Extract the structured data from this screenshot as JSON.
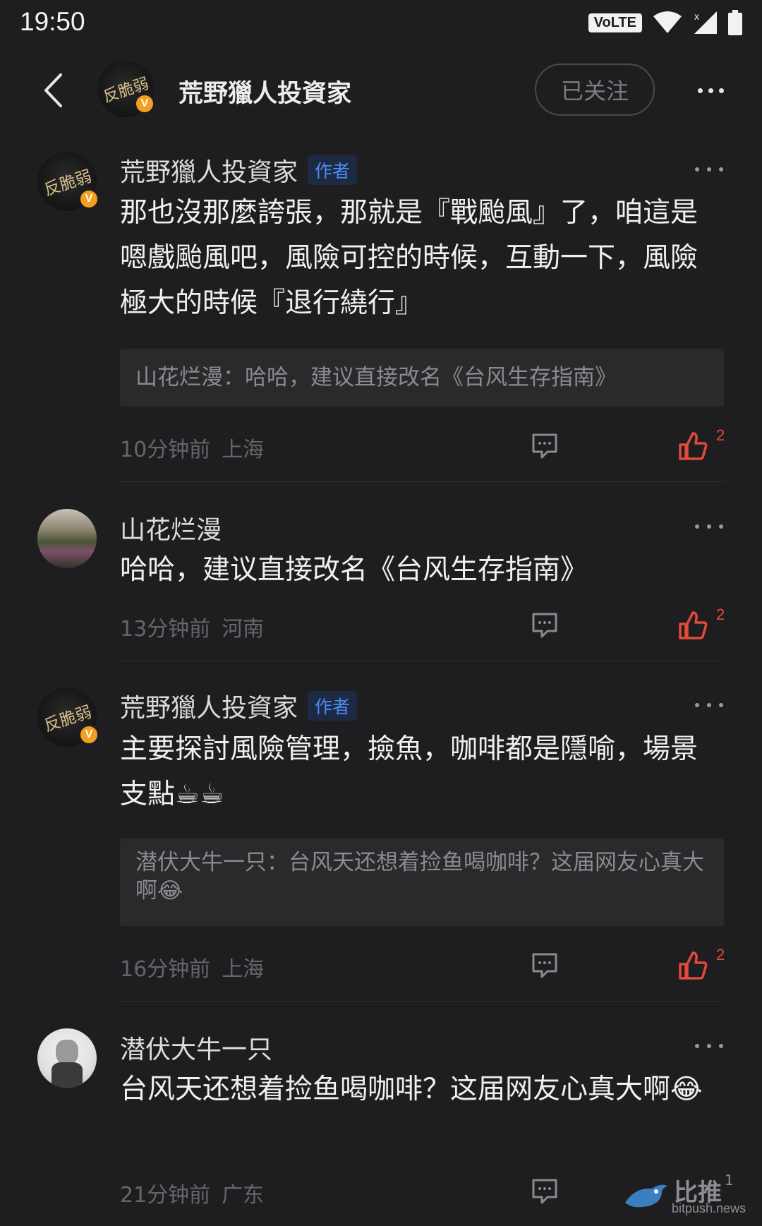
{
  "status_bar": {
    "time": "19:50",
    "network": "VoLTE"
  },
  "header": {
    "title": "荒野獵人投資家",
    "avatar_text": "反脆弱",
    "verified_mark": "V",
    "follow_label": "已关注"
  },
  "comments": [
    {
      "name": "荒野獵人投資家",
      "tag": "作者",
      "avatar_text": "反脆弱",
      "text": "那也沒那麼誇張，那就是『戰颱風』了，咱這是嗯戲颱風吧，風險可控的時候，互動一下，風險極大的時候『退行繞行』",
      "quote": "山花烂漫：哈哈，建议直接改名《台风生存指南》",
      "time": "10分钟前",
      "location": "上海",
      "likes": "2"
    },
    {
      "name": "山花烂漫",
      "text": "哈哈，建议直接改名《台风生存指南》",
      "time": "13分钟前",
      "location": "河南",
      "likes": "2"
    },
    {
      "name": "荒野獵人投資家",
      "tag": "作者",
      "avatar_text": "反脆弱",
      "text": "主要探討風險管理，撿魚，咖啡都是隱喻，場景支點☕☕",
      "quote": "潜伏大牛一只：台风天还想着捡鱼喝咖啡？这届网友心真大啊😂",
      "time": "16分钟前",
      "location": "上海",
      "likes": "2"
    },
    {
      "name": "潜伏大牛一只",
      "text": "台风天还想着捡鱼喝咖啡？这届网友心真大啊😂",
      "time": "21分钟前",
      "location": "广东"
    }
  ],
  "watermark": {
    "line1": "比推",
    "line2": "bitpush.news",
    "sup": "1"
  },
  "colors": {
    "background": "#1e1e20",
    "like": "#e24a3b",
    "author_tag": "#4d8cf2",
    "verified": "#f2a01e"
  }
}
